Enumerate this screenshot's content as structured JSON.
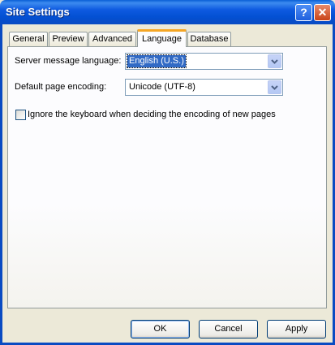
{
  "window": {
    "title": "Site Settings",
    "help_label": "?",
    "close_label": "✕"
  },
  "tabs": [
    {
      "label": "General",
      "active": false
    },
    {
      "label": "Preview",
      "active": false
    },
    {
      "label": "Advanced",
      "active": false
    },
    {
      "label": "Language",
      "active": true
    },
    {
      "label": "Database",
      "active": false
    }
  ],
  "language": {
    "server_language_label": "Server message language:",
    "server_language_value": "English (U.S.)",
    "encoding_label": "Default page encoding:",
    "encoding_value": "Unicode (UTF-8)",
    "ignore_keyboard_label": "Ignore the keyboard when deciding the encoding of new pages",
    "ignore_keyboard_checked": false
  },
  "buttons": {
    "ok": "OK",
    "cancel": "Cancel",
    "apply": "Apply"
  },
  "icons": {
    "dropdown": "chevron-down-icon",
    "help": "help-icon",
    "close": "close-icon"
  },
  "colors": {
    "titlebar": "#0a5fd6",
    "active_tab_accent": "#f5a624",
    "selection": "#316ac5"
  }
}
